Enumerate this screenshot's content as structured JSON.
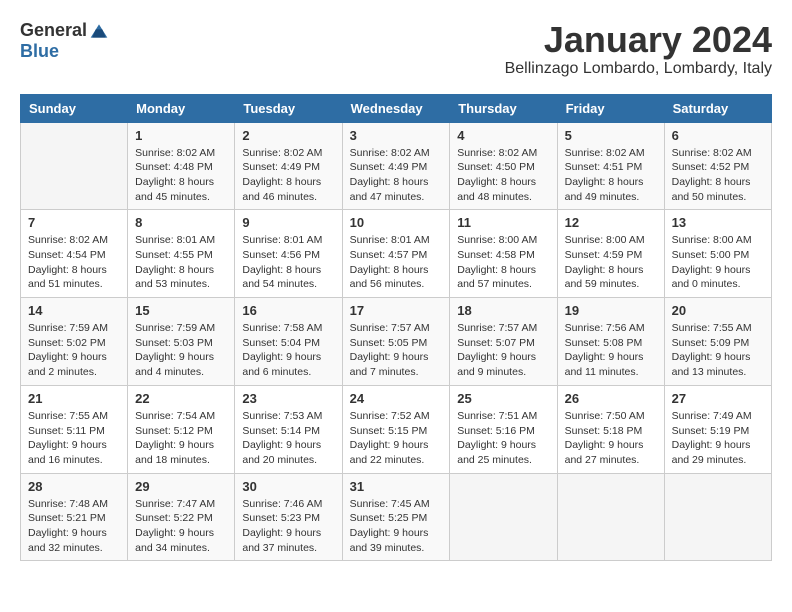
{
  "header": {
    "logo_general": "General",
    "logo_blue": "Blue",
    "month_title": "January 2024",
    "location": "Bellinzago Lombardo, Lombardy, Italy"
  },
  "days_of_week": [
    "Sunday",
    "Monday",
    "Tuesday",
    "Wednesday",
    "Thursday",
    "Friday",
    "Saturday"
  ],
  "weeks": [
    [
      {
        "day": "",
        "info": ""
      },
      {
        "day": "1",
        "info": "Sunrise: 8:02 AM\nSunset: 4:48 PM\nDaylight: 8 hours\nand 45 minutes."
      },
      {
        "day": "2",
        "info": "Sunrise: 8:02 AM\nSunset: 4:49 PM\nDaylight: 8 hours\nand 46 minutes."
      },
      {
        "day": "3",
        "info": "Sunrise: 8:02 AM\nSunset: 4:49 PM\nDaylight: 8 hours\nand 47 minutes."
      },
      {
        "day": "4",
        "info": "Sunrise: 8:02 AM\nSunset: 4:50 PM\nDaylight: 8 hours\nand 48 minutes."
      },
      {
        "day": "5",
        "info": "Sunrise: 8:02 AM\nSunset: 4:51 PM\nDaylight: 8 hours\nand 49 minutes."
      },
      {
        "day": "6",
        "info": "Sunrise: 8:02 AM\nSunset: 4:52 PM\nDaylight: 8 hours\nand 50 minutes."
      }
    ],
    [
      {
        "day": "7",
        "info": "Sunrise: 8:02 AM\nSunset: 4:54 PM\nDaylight: 8 hours\nand 51 minutes."
      },
      {
        "day": "8",
        "info": "Sunrise: 8:01 AM\nSunset: 4:55 PM\nDaylight: 8 hours\nand 53 minutes."
      },
      {
        "day": "9",
        "info": "Sunrise: 8:01 AM\nSunset: 4:56 PM\nDaylight: 8 hours\nand 54 minutes."
      },
      {
        "day": "10",
        "info": "Sunrise: 8:01 AM\nSunset: 4:57 PM\nDaylight: 8 hours\nand 56 minutes."
      },
      {
        "day": "11",
        "info": "Sunrise: 8:00 AM\nSunset: 4:58 PM\nDaylight: 8 hours\nand 57 minutes."
      },
      {
        "day": "12",
        "info": "Sunrise: 8:00 AM\nSunset: 4:59 PM\nDaylight: 8 hours\nand 59 minutes."
      },
      {
        "day": "13",
        "info": "Sunrise: 8:00 AM\nSunset: 5:00 PM\nDaylight: 9 hours\nand 0 minutes."
      }
    ],
    [
      {
        "day": "14",
        "info": "Sunrise: 7:59 AM\nSunset: 5:02 PM\nDaylight: 9 hours\nand 2 minutes."
      },
      {
        "day": "15",
        "info": "Sunrise: 7:59 AM\nSunset: 5:03 PM\nDaylight: 9 hours\nand 4 minutes."
      },
      {
        "day": "16",
        "info": "Sunrise: 7:58 AM\nSunset: 5:04 PM\nDaylight: 9 hours\nand 6 minutes."
      },
      {
        "day": "17",
        "info": "Sunrise: 7:57 AM\nSunset: 5:05 PM\nDaylight: 9 hours\nand 7 minutes."
      },
      {
        "day": "18",
        "info": "Sunrise: 7:57 AM\nSunset: 5:07 PM\nDaylight: 9 hours\nand 9 minutes."
      },
      {
        "day": "19",
        "info": "Sunrise: 7:56 AM\nSunset: 5:08 PM\nDaylight: 9 hours\nand 11 minutes."
      },
      {
        "day": "20",
        "info": "Sunrise: 7:55 AM\nSunset: 5:09 PM\nDaylight: 9 hours\nand 13 minutes."
      }
    ],
    [
      {
        "day": "21",
        "info": "Sunrise: 7:55 AM\nSunset: 5:11 PM\nDaylight: 9 hours\nand 16 minutes."
      },
      {
        "day": "22",
        "info": "Sunrise: 7:54 AM\nSunset: 5:12 PM\nDaylight: 9 hours\nand 18 minutes."
      },
      {
        "day": "23",
        "info": "Sunrise: 7:53 AM\nSunset: 5:14 PM\nDaylight: 9 hours\nand 20 minutes."
      },
      {
        "day": "24",
        "info": "Sunrise: 7:52 AM\nSunset: 5:15 PM\nDaylight: 9 hours\nand 22 minutes."
      },
      {
        "day": "25",
        "info": "Sunrise: 7:51 AM\nSunset: 5:16 PM\nDaylight: 9 hours\nand 25 minutes."
      },
      {
        "day": "26",
        "info": "Sunrise: 7:50 AM\nSunset: 5:18 PM\nDaylight: 9 hours\nand 27 minutes."
      },
      {
        "day": "27",
        "info": "Sunrise: 7:49 AM\nSunset: 5:19 PM\nDaylight: 9 hours\nand 29 minutes."
      }
    ],
    [
      {
        "day": "28",
        "info": "Sunrise: 7:48 AM\nSunset: 5:21 PM\nDaylight: 9 hours\nand 32 minutes."
      },
      {
        "day": "29",
        "info": "Sunrise: 7:47 AM\nSunset: 5:22 PM\nDaylight: 9 hours\nand 34 minutes."
      },
      {
        "day": "30",
        "info": "Sunrise: 7:46 AM\nSunset: 5:23 PM\nDaylight: 9 hours\nand 37 minutes."
      },
      {
        "day": "31",
        "info": "Sunrise: 7:45 AM\nSunset: 5:25 PM\nDaylight: 9 hours\nand 39 minutes."
      },
      {
        "day": "",
        "info": ""
      },
      {
        "day": "",
        "info": ""
      },
      {
        "day": "",
        "info": ""
      }
    ]
  ]
}
